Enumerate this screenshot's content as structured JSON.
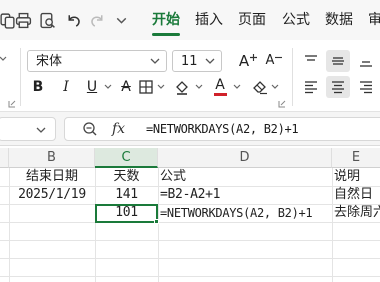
{
  "quick_toolbar": {
    "icons": [
      "copy-icon",
      "print-icon",
      "print-preview-icon",
      "undo-icon",
      "redo-icon",
      "more-icon"
    ]
  },
  "tabs": [
    {
      "label": "开始",
      "active": true
    },
    {
      "label": "插入"
    },
    {
      "label": "页面"
    },
    {
      "label": "公式"
    },
    {
      "label": "数据"
    },
    {
      "label": "审"
    }
  ],
  "ribbon": {
    "font_name": "宋体",
    "font_size": "11",
    "grow_font": "A",
    "shrink_font": "A",
    "bold": "B",
    "italic": "I",
    "underline": "U",
    "strikethrough": "A",
    "font_color": "A",
    "font_color_hex": "#d0212a"
  },
  "formula_bar": {
    "fx_label": "fx",
    "formula": "=NETWORKDAYS(A2, B2)+1"
  },
  "grid": {
    "columns": [
      "B",
      "C",
      "D",
      "E"
    ],
    "selected_column": "C",
    "rows": [
      {
        "B": "结束日期",
        "C": "天数",
        "D": "公式",
        "E": "说明"
      },
      {
        "B": "2025/1/19",
        "C": "141",
        "D": "=B2-A2+1",
        "E": "自然日"
      },
      {
        "B": "",
        "C": "101",
        "D": "=NETWORKDAYS(A2, B2)+1",
        "E": "去除周六"
      }
    ]
  },
  "colors": {
    "accent": "#1a7a3a"
  }
}
